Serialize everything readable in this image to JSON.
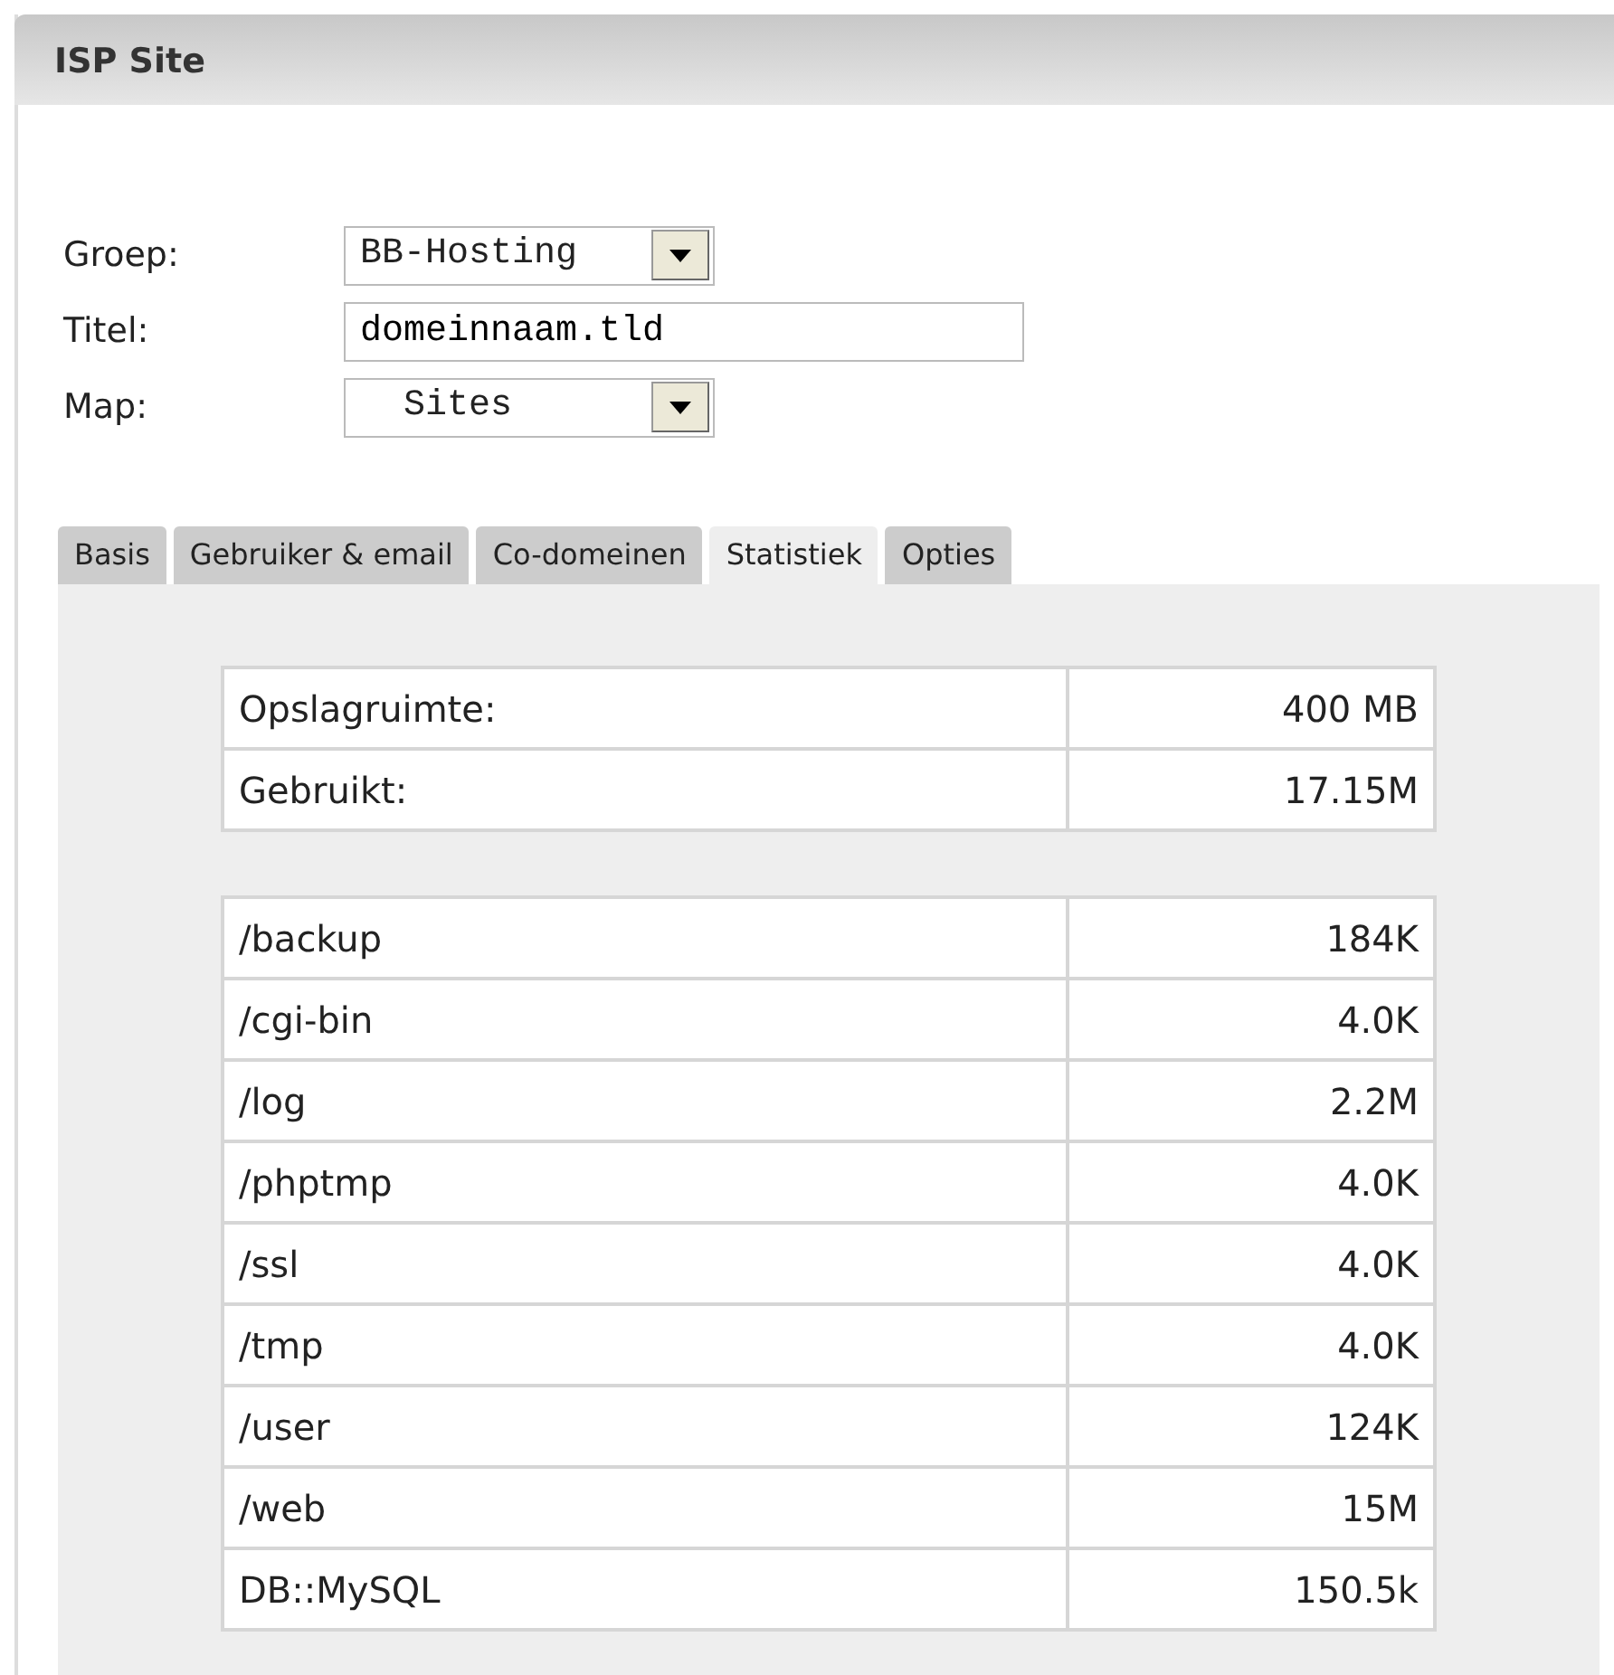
{
  "panel": {
    "title": "ISP Site"
  },
  "form": [
    {
      "kind": "select",
      "label": "Groep:",
      "value": "BB-Hosting"
    },
    {
      "kind": "text",
      "label": "Titel:",
      "value": "domeinnaam.tld"
    },
    {
      "kind": "select",
      "label": "Map:",
      "value": "  Sites"
    }
  ],
  "tabs": [
    {
      "label": "Basis",
      "selected": false
    },
    {
      "label": "Gebruiker & email",
      "selected": false
    },
    {
      "label": "Co-domeinen",
      "selected": false
    },
    {
      "label": "Statistiek",
      "selected": true
    },
    {
      "label": "Opties",
      "selected": false
    }
  ],
  "quota_table": [
    {
      "name": "Opslagruimte:",
      "value": "400 MB"
    },
    {
      "name": "Gebruikt:",
      "value": "17.15M"
    }
  ],
  "usage_table": [
    {
      "name": "/backup",
      "value": "184K"
    },
    {
      "name": "/cgi-bin",
      "value": "4.0K"
    },
    {
      "name": "/log",
      "value": "2.2M"
    },
    {
      "name": "/phptmp",
      "value": "4.0K"
    },
    {
      "name": "/ssl",
      "value": "4.0K"
    },
    {
      "name": "/tmp",
      "value": "4.0K"
    },
    {
      "name": "/user",
      "value": "124K"
    },
    {
      "name": "/web",
      "value": "15M"
    },
    {
      "name": "DB::MySQL",
      "value": "150.5k"
    }
  ]
}
